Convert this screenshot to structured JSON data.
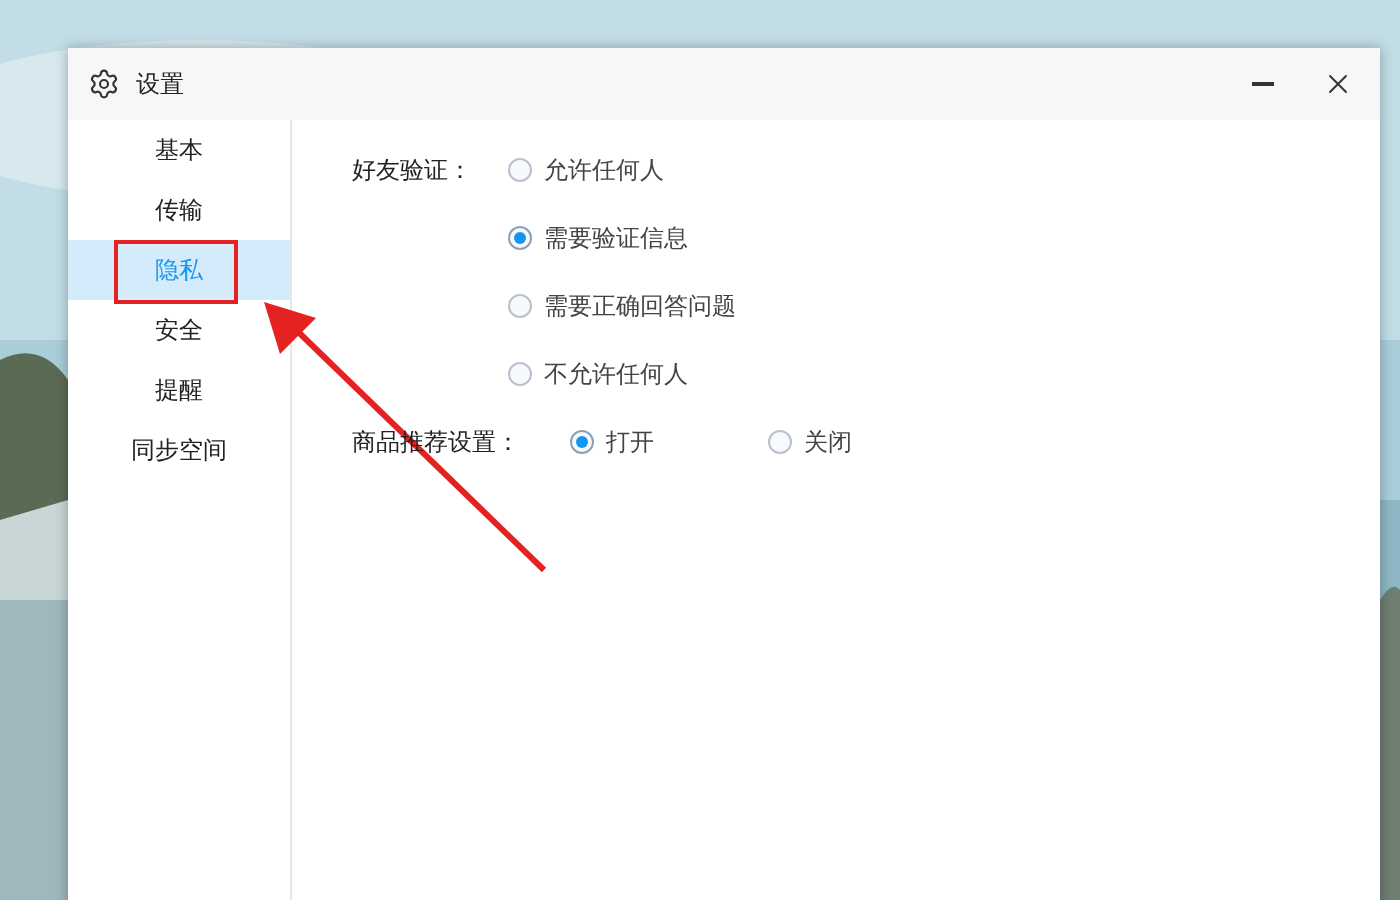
{
  "window": {
    "title": "设置"
  },
  "sidebar": {
    "items": [
      {
        "label": "基本",
        "selected": false
      },
      {
        "label": "传输",
        "selected": false
      },
      {
        "label": "隐私",
        "selected": true
      },
      {
        "label": "安全",
        "selected": false
      },
      {
        "label": "提醒",
        "selected": false
      },
      {
        "label": "同步空间",
        "selected": false
      }
    ]
  },
  "friend_verification": {
    "label": "好友验证：",
    "options": [
      {
        "label": "允许任何人",
        "selected": false
      },
      {
        "label": "需要验证信息",
        "selected": true
      },
      {
        "label": "需要正确回答问题",
        "selected": false
      },
      {
        "label": "不允许任何人",
        "selected": false
      }
    ]
  },
  "product_recommendation": {
    "label": "商品推荐设置：",
    "options": [
      {
        "label": "打开",
        "selected": true
      },
      {
        "label": "关闭",
        "selected": false
      }
    ]
  }
}
